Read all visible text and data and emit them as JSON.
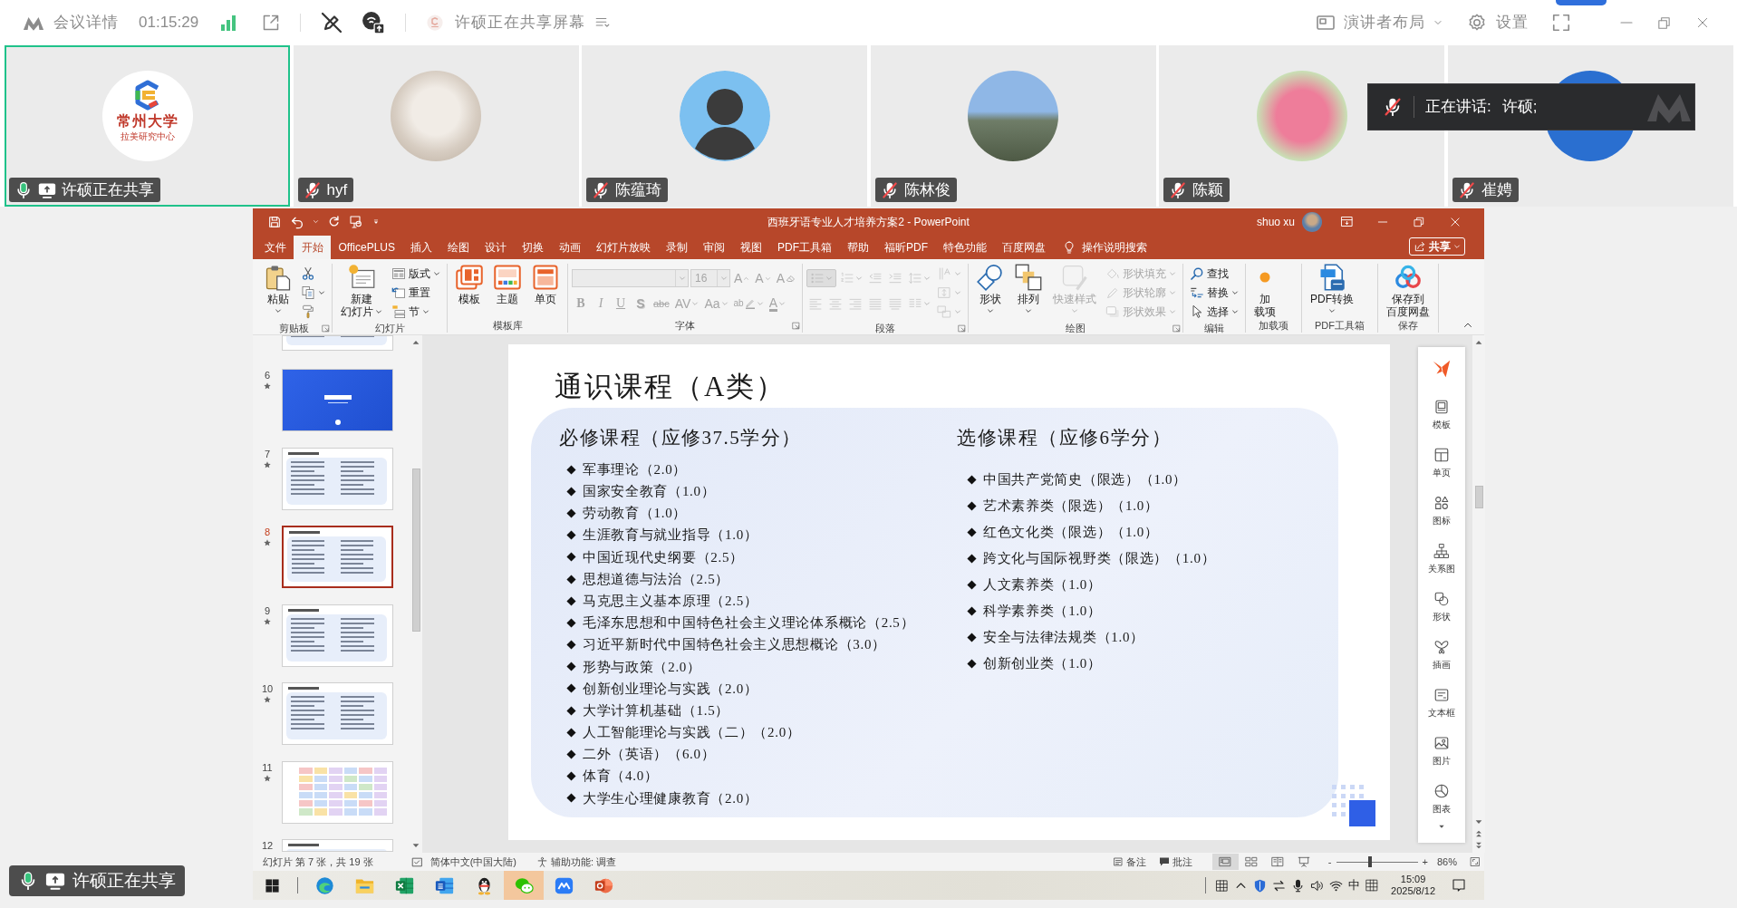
{
  "meeting_bar": {
    "title": "会议详情",
    "timer": "01:15:29",
    "sharing_status": "许硕正在共享屏幕",
    "layout_button": "演讲者布局",
    "settings_button": "设置"
  },
  "participants": [
    {
      "name": "许硕正在共享",
      "kind": "logo",
      "avatar_text": [
        "常州大学",
        "拉美研究中心"
      ],
      "selected": true,
      "muted": false,
      "sharing": true
    },
    {
      "name": "hyf",
      "kind": "photo",
      "selected": false,
      "muted": true,
      "sharing": false
    },
    {
      "name": "陈蕴琦",
      "kind": "cartoon",
      "selected": false,
      "muted": true,
      "sharing": false
    },
    {
      "name": "陈林俊",
      "kind": "landscape",
      "selected": false,
      "muted": true,
      "sharing": false
    },
    {
      "name": "陈颖",
      "kind": "flower",
      "selected": false,
      "muted": true,
      "sharing": false
    },
    {
      "name": "崔娉",
      "kind": "plain",
      "selected": false,
      "muted": true,
      "sharing": false
    }
  ],
  "speaking_banner": {
    "label": "正在讲话:",
    "speaker": "许硕;",
    "muted": true
  },
  "sharing_badge": {
    "label": "许硕正在共享",
    "muted": false,
    "sharing": true
  },
  "powerpoint": {
    "title": "西班牙语专业人才培养方案2 - PowerPoint",
    "user": "shuo xu",
    "tabs": [
      {
        "label": "文件",
        "selected": false
      },
      {
        "label": "开始",
        "selected": true
      },
      {
        "label": "OfficePLUS",
        "selected": false
      },
      {
        "label": "插入",
        "selected": false
      },
      {
        "label": "绘图",
        "selected": false
      },
      {
        "label": "设计",
        "selected": false
      },
      {
        "label": "切换",
        "selected": false
      },
      {
        "label": "动画",
        "selected": false
      },
      {
        "label": "幻灯片放映",
        "selected": false
      },
      {
        "label": "录制",
        "selected": false
      },
      {
        "label": "审阅",
        "selected": false
      },
      {
        "label": "视图",
        "selected": false
      },
      {
        "label": "PDF工具箱",
        "selected": false
      },
      {
        "label": "帮助",
        "selected": false
      },
      {
        "label": "福昕PDF",
        "selected": false
      },
      {
        "label": "特色功能",
        "selected": false
      },
      {
        "label": "百度网盘",
        "selected": false
      }
    ],
    "tell_me": "操作说明搜索",
    "share_button": "共享",
    "ribbon": [
      {
        "label": "剪贴板",
        "launcher": true,
        "items": [
          {
            "label": "粘贴",
            "kind": "paste",
            "disabled": false,
            "dropdown": true
          },
          {
            "stack": [
              {
                "kind": "cut",
                "disabled": false
              },
              {
                "kind": "copy",
                "disabled": false,
                "dropdown": true
              },
              {
                "kind": "painter",
                "disabled": false
              }
            ]
          }
        ]
      },
      {
        "label": "幻灯片",
        "items": [
          {
            "lines": [
              "新建",
              "幻灯片"
            ],
            "kind": "newslide",
            "disabled": false,
            "dropdown": true
          },
          {
            "stack": [
              {
                "label": "版式",
                "kind": "layout",
                "disabled": false,
                "dropdown": true
              },
              {
                "label": "重置",
                "kind": "reset",
                "disabled": false
              },
              {
                "label": "节",
                "kind": "section",
                "disabled": false,
                "dropdown": true
              }
            ]
          }
        ]
      },
      {
        "label": "模板库",
        "items": [
          {
            "label": "模板",
            "kind": "template",
            "disabled": false
          },
          {
            "label": "主题",
            "kind": "theme",
            "disabled": false
          },
          {
            "label": "单页",
            "kind": "page",
            "disabled": false
          }
        ]
      },
      {
        "label": "字体",
        "launcher": true,
        "items": [
          {
            "top_row": [
              {
                "kind": "fontname",
                "disabled": true,
                "dropdown": true
              },
              {
                "kind": "fontsize",
                "value": "16",
                "disabled": true,
                "dropdown": true
              },
              {
                "label": "A",
                "kind": "grow",
                "disabled": true
              },
              {
                "label": "A",
                "kind": "shrink",
                "disabled": true
              },
              {
                "label": "A",
                "kind": "clear",
                "disabled": true
              }
            ],
            "bottom_row": [
              {
                "label": "B",
                "kind": "bold",
                "disabled": true
              },
              {
                "label": "I",
                "kind": "italic",
                "disabled": true
              },
              {
                "label": "U",
                "kind": "underline",
                "disabled": true
              },
              {
                "label": "S",
                "kind": "shadow",
                "disabled": true
              },
              {
                "label": "abc",
                "kind": "strike",
                "disabled": true
              },
              {
                "label": "AV",
                "kind": "spacing",
                "disabled": true,
                "dropdown": true
              },
              {
                "label": "Aa",
                "kind": "case",
                "disabled": true,
                "dropdown": true
              },
              {
                "label": "ab",
                "kind": "highlight",
                "disabled": true,
                "dropdown": true
              },
              {
                "label": "A",
                "kind": "color",
                "disabled": true,
                "dropdown": true
              }
            ]
          }
        ]
      },
      {
        "label": "段落",
        "launcher": true,
        "items": [
          {
            "top_row": [
              {
                "kind": "bullets",
                "disabled": true,
                "dropdown": true
              },
              {
                "kind": "numbering",
                "disabled": true,
                "dropdown": true
              },
              {
                "kind": "outdent",
                "disabled": true
              },
              {
                "kind": "indent",
                "disabled": true
              },
              {
                "kind": "linespacing",
                "disabled": true,
                "dropdown": true
              }
            ],
            "bottom_row": [
              {
                "kind": "left",
                "disabled": true
              },
              {
                "kind": "center",
                "disabled": true
              },
              {
                "kind": "right",
                "disabled": true
              },
              {
                "kind": "justify",
                "disabled": true
              },
              {
                "kind": "distribute",
                "disabled": true
              },
              {
                "kind": "columns",
                "disabled": true,
                "dropdown": true
              }
            ]
          },
          {
            "stack": [
              {
                "kind": "textdir",
                "disabled": true,
                "dropdown": true
              },
              {
                "kind": "aligntext",
                "disabled": true,
                "dropdown": true
              },
              {
                "kind": "smartart",
                "disabled": true,
                "dropdown": true
              }
            ]
          }
        ]
      },
      {
        "label": "绘图",
        "launcher": true,
        "items": [
          {
            "label": "形状",
            "kind": "shape",
            "disabled": false,
            "dropdown": true
          },
          {
            "label": "排列",
            "kind": "arrange",
            "disabled": false,
            "dropdown": true
          },
          {
            "label": "快速样式",
            "kind": "quickstyle",
            "disabled": true,
            "dropdown": true
          },
          {
            "stack": [
              {
                "label": "形状填充",
                "kind": "fill",
                "disabled": true,
                "dropdown": true
              },
              {
                "label": "形状轮廓",
                "kind": "outline",
                "disabled": true,
                "dropdown": true
              },
              {
                "label": "形状效果",
                "kind": "effect",
                "disabled": true,
                "dropdown": true
              }
            ]
          }
        ]
      },
      {
        "label": "编辑",
        "items": [
          {
            "stack": [
              {
                "label": "查找",
                "kind": "find",
                "disabled": false
              },
              {
                "label": "替换",
                "kind": "replace",
                "disabled": false,
                "dropdown": true
              },
              {
                "label": "选择",
                "kind": "select",
                "disabled": false,
                "dropdown": true
              }
            ]
          }
        ]
      },
      {
        "label": "加载项",
        "items": [
          {
            "lines": [
              "加",
              "载项"
            ],
            "kind": "addin",
            "disabled": false
          }
        ]
      },
      {
        "label": "PDF工具箱",
        "items": [
          {
            "label": "PDF转换",
            "kind": "pdf",
            "disabled": false,
            "dropdown": true
          }
        ]
      },
      {
        "label": "保存",
        "items": [
          {
            "lines": [
              "保存到",
              "百度网盘"
            ],
            "kind": "cloud",
            "disabled": false
          }
        ]
      }
    ],
    "slides": [
      {
        "kind": "lower",
        "selected": false,
        "animated": false
      },
      {
        "number": "6",
        "kind": "title",
        "selected": false,
        "animated": true
      },
      {
        "number": "7",
        "kind": "list",
        "selected": false,
        "animated": true
      },
      {
        "number": "8",
        "kind": "list",
        "selected": true,
        "animated": true
      },
      {
        "number": "9",
        "kind": "list",
        "selected": false,
        "animated": true
      },
      {
        "number": "10",
        "kind": "list",
        "selected": false,
        "animated": true
      },
      {
        "number": "11",
        "kind": "table",
        "selected": false,
        "animated": true
      },
      {
        "number": "12",
        "kind": "upper",
        "selected": false,
        "animated": false
      }
    ],
    "slide": {
      "title": "通识课程（A类）",
      "columns": [
        {
          "heading": "必修课程（应修37.5学分）",
          "items": [
            "军事理论（2.0）",
            "国家安全教育（1.0）",
            "劳动教育（1.0）",
            "生涯教育与就业指导（1.0）",
            "中国近现代史纲要（2.5）",
            "思想道德与法治（2.5）",
            "马克思主义基本原理（2.5）",
            "毛泽东思想和中国特色社会主义理论体系概论（2.5）",
            "习近平新时代中国特色社会主义思想概论（3.0）",
            "形势与政策（2.0）",
            "创新创业理论与实践（2.0）",
            "大学计算机基础（1.5）",
            "人工智能理论与实践（二）（2.0）",
            "二外（英语）（6.0）",
            "体育（4.0）",
            "大学生心理健康教育（2.0）"
          ]
        },
        {
          "heading": "选修课程（应修6学分）",
          "items": [
            "中国共产党简史（限选）（1.0）",
            "艺术素养类（限选）（1.0）",
            "红色文化类（限选）（1.0）",
            "跨文化与国际视野类（限选）（1.0）",
            "人文素养类（1.0）",
            "科学素养类（1.0）",
            "安全与法律法规类（1.0）",
            "创新创业类（1.0）"
          ]
        }
      ]
    },
    "side_panel": [
      {
        "kind": "brand"
      },
      {
        "label": "模板",
        "kind": "template"
      },
      {
        "label": "单页",
        "kind": "page"
      },
      {
        "label": "图标",
        "kind": "icons"
      },
      {
        "label": "关系图",
        "kind": "diagram"
      },
      {
        "label": "形状",
        "kind": "shapes"
      },
      {
        "label": "插画",
        "kind": "illustration"
      },
      {
        "label": "文本框",
        "kind": "textbox"
      },
      {
        "label": "图片",
        "kind": "picture"
      },
      {
        "label": "图表",
        "kind": "chart"
      }
    ],
    "status_bar": {
      "slide_position": "幻灯片 第 7 张，共 19 张",
      "language": "简体中文(中国大陆)",
      "accessibility": "辅助功能: 调查",
      "notes": "备注",
      "comments": "批注",
      "views": [
        {
          "kind": "normal",
          "selected": true
        },
        {
          "kind": "sorter",
          "selected": false
        },
        {
          "kind": "reading",
          "selected": false
        },
        {
          "kind": "show",
          "selected": false
        }
      ],
      "zoom_out": "-",
      "zoom": {
        "level": 0.42
      },
      "zoom_in": "+",
      "zoom_label": "86%"
    }
  },
  "taskbar": {
    "apps": [
      {
        "kind": "start",
        "selected": false
      },
      {
        "kind": "browser",
        "selected": false
      },
      {
        "kind": "folder",
        "selected": false
      },
      {
        "kind": "spreadsheet",
        "selected": false
      },
      {
        "kind": "document",
        "selected": false
      },
      {
        "kind": "penguin",
        "selected": false
      },
      {
        "kind": "chat",
        "selected": true
      },
      {
        "kind": "meeting",
        "selected": false
      },
      {
        "kind": "presentation",
        "selected": false
      }
    ],
    "input_mode": "中",
    "time": "15:09",
    "date": "2025/8/12"
  }
}
